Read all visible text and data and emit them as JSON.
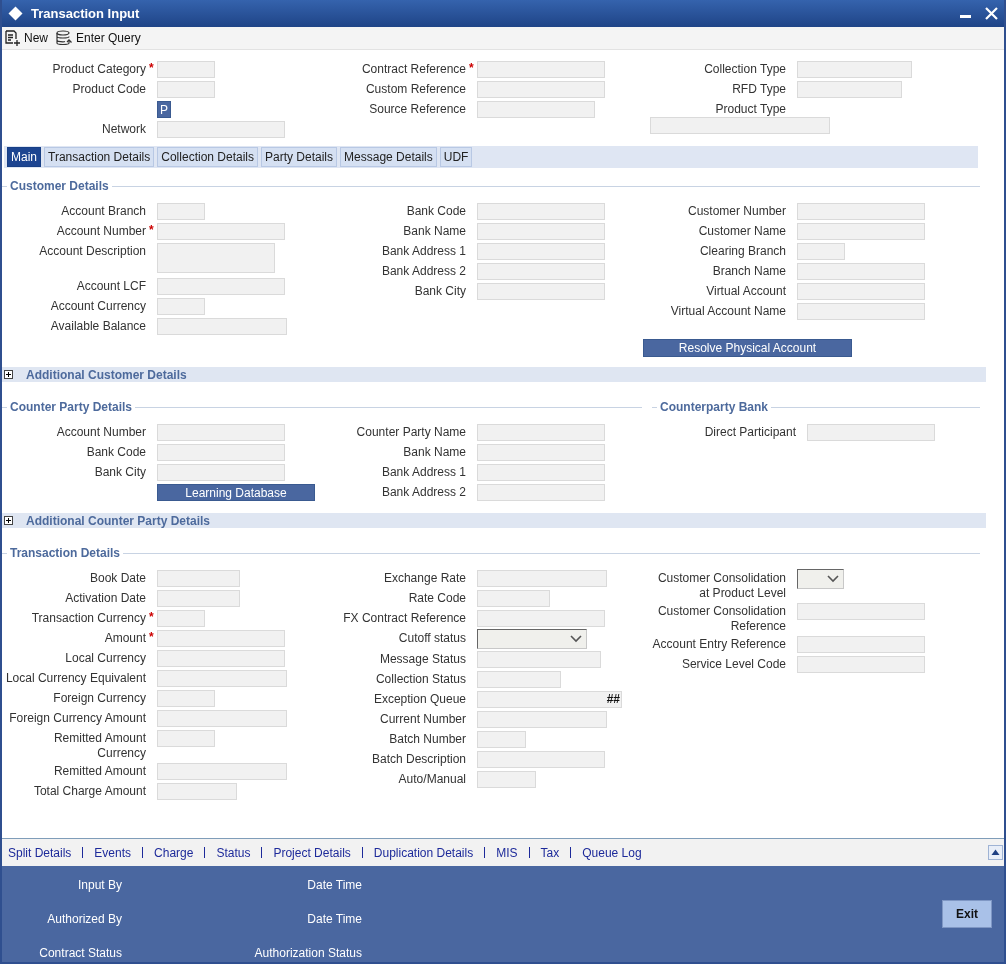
{
  "window": {
    "title": "Transaction Input"
  },
  "toolbar": [
    {
      "kind": "new",
      "label": "New"
    },
    {
      "kind": "query",
      "label": "Enter Query"
    }
  ],
  "header": {
    "columns": [
      [
        {
          "kind": "text",
          "label": "Product Category",
          "required_mark": "*"
        },
        {
          "kind": "text",
          "label": "Product Code"
        },
        {
          "kind": "button",
          "label": "P"
        },
        {
          "kind": "text",
          "label": "Network"
        }
      ],
      [
        {
          "kind": "text",
          "label": "Contract Reference",
          "required_mark": "*"
        },
        {
          "kind": "text",
          "label": "Custom Reference"
        },
        {
          "kind": "text",
          "label": "Source Reference"
        }
      ],
      [
        {
          "kind": "text",
          "label": "Collection Type"
        },
        {
          "kind": "text",
          "label": "RFD Type"
        },
        {
          "kind": "label",
          "label": "Product Type"
        },
        {
          "kind": "blank-field"
        }
      ]
    ]
  },
  "tabs": [
    {
      "label": "Main",
      "selected": true
    },
    {
      "label": "Transaction Details",
      "selected": false
    },
    {
      "label": "Collection Details",
      "selected": false
    },
    {
      "label": "Party Details",
      "selected": false
    },
    {
      "label": "Message Details",
      "selected": false
    },
    {
      "label": "UDF",
      "selected": false
    }
  ],
  "sections": [
    {
      "kind": "group",
      "groups": [
        {
          "title": "Customer Details",
          "columns": [
            [
              {
                "kind": "text",
                "label": "Account Branch"
              },
              {
                "kind": "text",
                "label": "Account Number",
                "required_mark": "*"
              },
              {
                "kind": "textarea",
                "label": "Account Description"
              },
              {
                "kind": "text",
                "label": "Account LCF"
              },
              {
                "kind": "text",
                "label": "Account Currency"
              },
              {
                "kind": "text",
                "label": "Available Balance"
              }
            ],
            [
              {
                "kind": "text",
                "label": "Bank Code"
              },
              {
                "kind": "text",
                "label": "Bank Name"
              },
              {
                "kind": "text",
                "label": "Bank Address 1"
              },
              {
                "kind": "text",
                "label": "Bank Address 2"
              },
              {
                "kind": "text",
                "label": "Bank City"
              }
            ],
            [
              {
                "kind": "text",
                "label": "Customer Number"
              },
              {
                "kind": "text",
                "label": "Customer Name"
              },
              {
                "kind": "text",
                "label": "Clearing Branch"
              },
              {
                "kind": "text",
                "label": "Branch Name"
              },
              {
                "kind": "text",
                "label": "Virtual Account"
              },
              {
                "kind": "text",
                "label": "Virtual Account Name"
              },
              {
                "kind": "bar-button",
                "label": "Resolve Physical Account"
              }
            ]
          ]
        }
      ]
    },
    {
      "kind": "collapsible",
      "title": "Additional Customer Details",
      "expanded": false
    },
    {
      "kind": "group",
      "groups": [
        {
          "title": "Counter Party Details",
          "columns": [
            [
              {
                "kind": "text",
                "label": "Account Number"
              },
              {
                "kind": "text",
                "label": "Bank Code"
              },
              {
                "kind": "text",
                "label": "Bank City"
              },
              {
                "kind": "button",
                "label": "Learning Database"
              }
            ],
            [
              {
                "kind": "text",
                "label": "Counter Party Name"
              },
              {
                "kind": "text",
                "label": "Bank Name"
              },
              {
                "kind": "text",
                "label": "Bank Address 1"
              },
              {
                "kind": "text",
                "label": "Bank Address 2"
              }
            ]
          ]
        },
        {
          "title": "Counterparty Bank",
          "columns": [
            [
              {
                "kind": "text",
                "label": "Direct Participant"
              }
            ]
          ]
        }
      ]
    },
    {
      "kind": "collapsible",
      "title": "Additional Counter Party Details",
      "expanded": false
    },
    {
      "kind": "group",
      "groups": [
        {
          "title": "Transaction Details",
          "columns": [
            [
              {
                "kind": "text",
                "label": "Book Date"
              },
              {
                "kind": "text",
                "label": "Activation Date"
              },
              {
                "kind": "text",
                "label": "Transaction Currency",
                "required_mark": "*"
              },
              {
                "kind": "text",
                "label": "Amount",
                "required_mark": "*"
              },
              {
                "kind": "text",
                "label": "Local Currency"
              },
              {
                "kind": "text",
                "label": "Local Currency Equivalent"
              },
              {
                "kind": "text",
                "label": "Foreign Currency"
              },
              {
                "kind": "text",
                "label": "Foreign Currency Amount"
              },
              {
                "kind": "text",
                "label": "Remitted Amount\nCurrency"
              },
              {
                "kind": "text",
                "label": "Remitted Amount"
              },
              {
                "kind": "text",
                "label": "Total Charge Amount"
              }
            ],
            [
              {
                "kind": "text",
                "label": "Exchange Rate"
              },
              {
                "kind": "text",
                "label": "Rate Code"
              },
              {
                "kind": "text",
                "label": "FX Contract Reference"
              },
              {
                "kind": "select",
                "label": "Cutoff status"
              },
              {
                "kind": "text",
                "label": "Message Status"
              },
              {
                "kind": "text",
                "label": "Collection Status"
              },
              {
                "kind": "text",
                "label": "Exception Queue",
                "suffix": "##"
              },
              {
                "kind": "text",
                "label": "Current Number"
              },
              {
                "kind": "text",
                "label": "Batch Number"
              },
              {
                "kind": "text",
                "label": "Batch Description"
              },
              {
                "kind": "text",
                "label": "Auto/Manual"
              }
            ],
            [
              {
                "kind": "select",
                "label": "Customer Consolidation\nat Product Level"
              },
              {
                "kind": "text",
                "label": "Customer Consolidation\nReference"
              },
              {
                "kind": "text",
                "label": "Account Entry Reference"
              },
              {
                "kind": "text",
                "label": "Service Level Code"
              }
            ]
          ]
        }
      ]
    }
  ],
  "links": [
    "Split Details",
    "Events",
    "Charge",
    "Status",
    "Project Details",
    "Duplication Details",
    "MIS",
    "Tax",
    "Queue Log"
  ],
  "audit": [
    {
      "left": "Input By",
      "right": "Date Time"
    },
    {
      "left": "Authorized By",
      "right": "Date Time"
    },
    {
      "left": "Contract Status",
      "right": "Authorization Status"
    }
  ],
  "exit_button": "Exit"
}
